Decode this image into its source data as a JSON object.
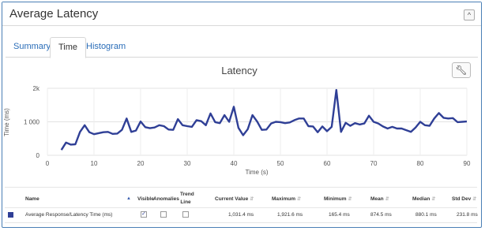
{
  "panel": {
    "title": "Average Latency",
    "collapse_icon": "^"
  },
  "tabs": [
    {
      "label": "Summary",
      "active": false
    },
    {
      "label": "Time",
      "active": true
    },
    {
      "label": "Histogram",
      "active": false
    }
  ],
  "chart_data": {
    "type": "line",
    "title": "Latency",
    "xlabel": "Time (s)",
    "ylabel": "Time (ms)",
    "xlim": [
      0,
      90
    ],
    "ylim": [
      0,
      2000
    ],
    "xticks": [
      0,
      10,
      20,
      30,
      40,
      50,
      60,
      70,
      80,
      90
    ],
    "yticks": [
      0,
      1000,
      2000
    ],
    "ytick_labels": [
      "0",
      "1 000",
      "2k"
    ],
    "grid": true,
    "series": [
      {
        "name": "Average Response/Latency Time (ms)",
        "color": "#2f3f96",
        "x": [
          3,
          4,
          5,
          6,
          7,
          8,
          9,
          10,
          11,
          12,
          13,
          14,
          15,
          16,
          17,
          18,
          19,
          20,
          21,
          22,
          23,
          24,
          25,
          26,
          27,
          28,
          29,
          30,
          31,
          32,
          33,
          34,
          35,
          36,
          37,
          38,
          39,
          40,
          41,
          42,
          43,
          44,
          45,
          46,
          47,
          48,
          49,
          50,
          51,
          52,
          53,
          54,
          55,
          56,
          57,
          58,
          59,
          60,
          61,
          62,
          63,
          64,
          65,
          66,
          67,
          68,
          69,
          70,
          71,
          72,
          73,
          74,
          75,
          76,
          77,
          78,
          79,
          80,
          81,
          82,
          83,
          84,
          85,
          86,
          87,
          88,
          89,
          90
        ],
        "y": [
          160,
          380,
          320,
          330,
          700,
          900,
          690,
          630,
          660,
          690,
          700,
          640,
          650,
          760,
          1100,
          700,
          740,
          1010,
          840,
          810,
          830,
          900,
          870,
          770,
          760,
          1080,
          900,
          870,
          850,
          1050,
          1020,
          900,
          1250,
          990,
          960,
          1200,
          1000,
          1450,
          820,
          600,
          780,
          1200,
          1010,
          760,
          770,
          950,
          1000,
          990,
          960,
          980,
          1050,
          1100,
          1100,
          870,
          860,
          690,
          860,
          720,
          850,
          1950,
          700,
          970,
          880,
          960,
          920,
          950,
          1180,
          1000,
          950,
          860,
          800,
          850,
          800,
          800,
          750,
          700,
          830,
          1000,
          900,
          880,
          1100,
          1260,
          1120,
          1100,
          1110,
          990,
          1000,
          1010
        ]
      }
    ]
  },
  "table": {
    "headers": {
      "name": "Name",
      "visible": "Visible",
      "anomalies": "Anomalies",
      "trend_line": "Trend Line",
      "current": "Current Value",
      "maximum": "Maximum",
      "minimum": "Minimum",
      "mean": "Mean",
      "median": "Median",
      "stddev": "Std Dev"
    },
    "rows": [
      {
        "color": "#2f3f96",
        "name": "Average Response/Latency Time (ms)",
        "visible": true,
        "anomalies": false,
        "trend_line": false,
        "current": "1,031.4 ms",
        "maximum": "1,921.6 ms",
        "minimum": "165.4 ms",
        "mean": "874.5 ms",
        "median": "880.1 ms",
        "stddev": "231.8 ms"
      }
    ]
  }
}
